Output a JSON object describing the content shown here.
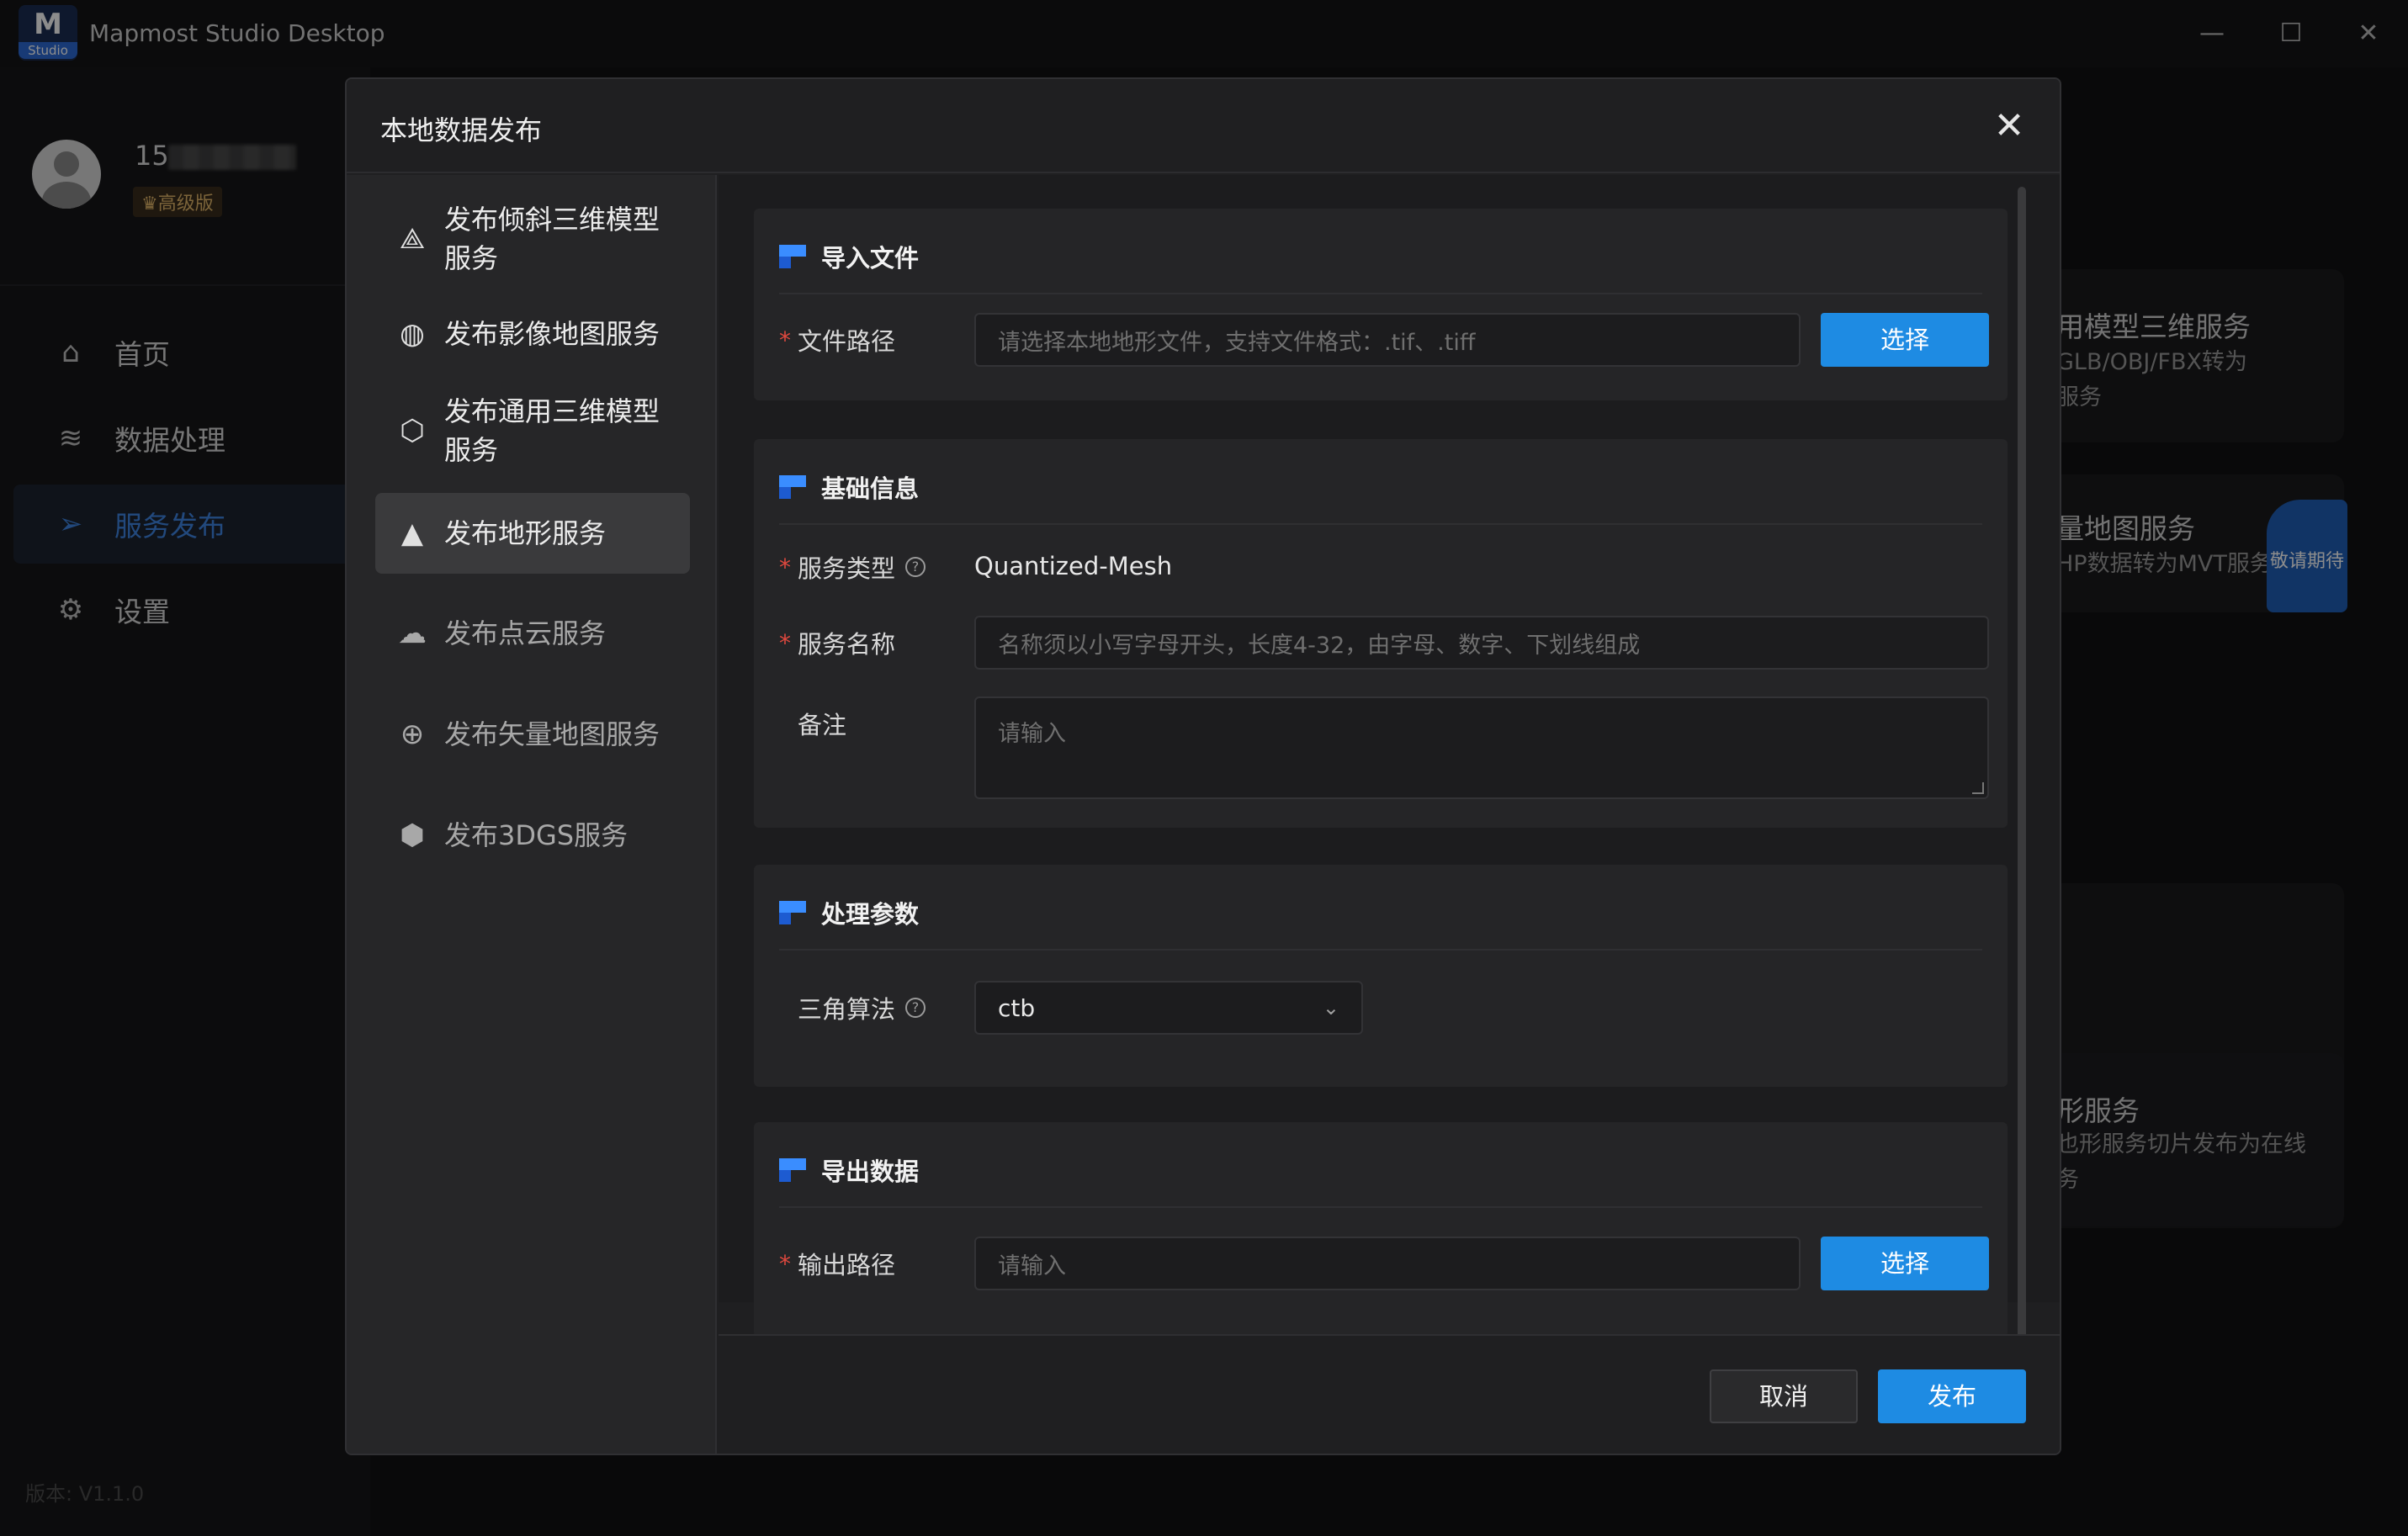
{
  "app": {
    "logo_text": "M",
    "logo_sub": "Studio",
    "title": "Mapmost Studio Desktop",
    "minimize": "—",
    "maximize": "☐",
    "close": "✕"
  },
  "user": {
    "id_prefix": "15",
    "badge": "♛高级版"
  },
  "nav": [
    {
      "label": "首页",
      "icon": "home-icon",
      "active": false
    },
    {
      "label": "数据处理",
      "icon": "database-icon",
      "active": false
    },
    {
      "label": "服务发布",
      "icon": "send-icon",
      "active": true
    },
    {
      "label": "设置",
      "icon": "gear-icon",
      "active": false
    }
  ],
  "version": "版本: V1.1.0",
  "background_cards": {
    "card1_title": "用模型三维服务",
    "card1_desc": "GLB/OBJ/FBX转为\n服务",
    "card2_title": "量地图服务",
    "card2_desc": "HP数据转为MVT服务",
    "card2_badge": "敬请期待",
    "card3_title": "形服务",
    "card3_desc": "也形服务切片发布为在线\n务"
  },
  "dialog": {
    "title": "本地数据发布",
    "close": "✕",
    "services": [
      {
        "label": "发布倾斜三维模型服务",
        "icon": "pyramid-icon",
        "active": false,
        "disabled": false
      },
      {
        "label": "发布影像地图服务",
        "icon": "globe-icon",
        "active": false,
        "disabled": false
      },
      {
        "label": "发布通用三维模型服务",
        "icon": "cube-icon",
        "active": false,
        "disabled": false
      },
      {
        "label": "发布地形服务",
        "icon": "mountain-icon",
        "active": true,
        "disabled": false
      },
      {
        "label": "发布点云服务",
        "icon": "cloud-icon",
        "active": false,
        "disabled": true
      },
      {
        "label": "发布矢量地图服务",
        "icon": "grid-globe-icon",
        "active": false,
        "disabled": true
      },
      {
        "label": "发布3DGS服务",
        "icon": "hex-icon",
        "active": false,
        "disabled": true
      }
    ],
    "sections": {
      "import": {
        "title": "导入文件",
        "file_path_label": "文件路径",
        "file_path_placeholder": "请选择本地地形文件，支持文件格式：.tif、.tiff",
        "select_button": "选择"
      },
      "basic": {
        "title": "基础信息",
        "service_type_label": "服务类型",
        "service_type_value": "Quantized-Mesh",
        "service_name_label": "服务名称",
        "service_name_placeholder": "名称须以小写字母开头，长度4-32，由字母、数字、下划线组成",
        "remark_label": "备注",
        "remark_placeholder": "请输入"
      },
      "params": {
        "title": "处理参数",
        "algorithm_label": "三角算法",
        "algorithm_value": "ctb"
      },
      "export": {
        "title": "导出数据",
        "output_label": "输出路径",
        "output_placeholder": "请输入",
        "select_button": "选择"
      }
    },
    "cancel_button": "取消",
    "publish_button": "发布",
    "required_mark": "*",
    "help_mark": "?"
  }
}
